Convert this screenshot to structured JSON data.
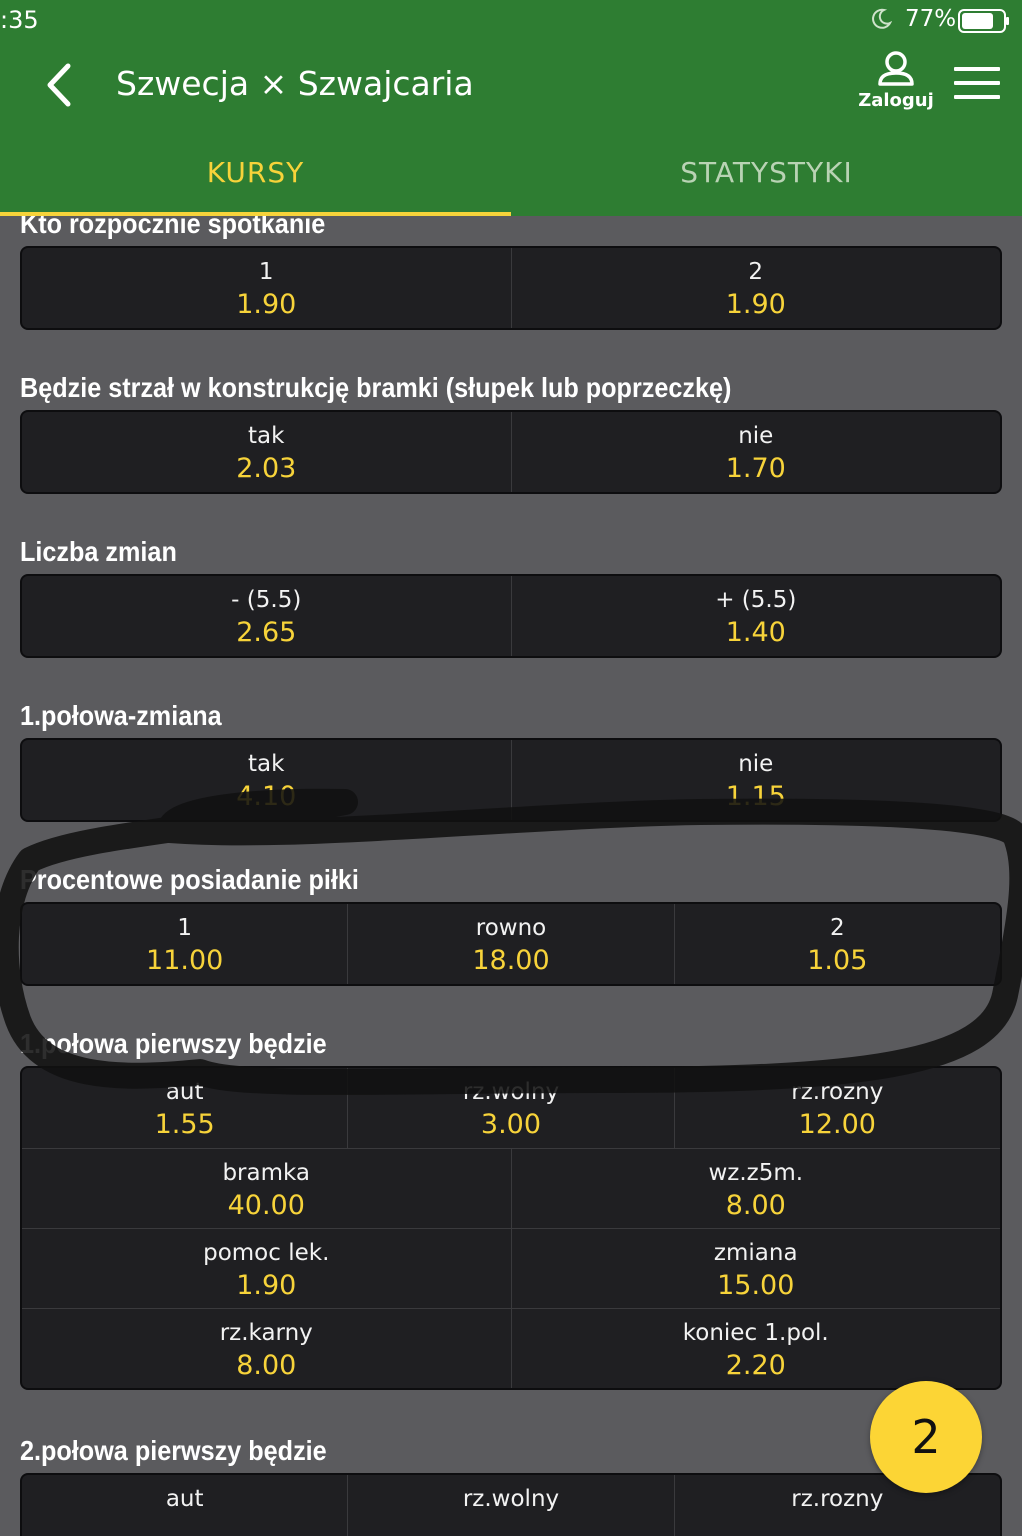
{
  "status_bar": {
    "time": ":35",
    "battery_percent": "77%",
    "battery_level": 0.77
  },
  "header": {
    "back_icon": "chevron-left-icon",
    "title": "Szwecja × Szwajcaria",
    "login_label": "Zaloguj",
    "login_icon": "user-icon",
    "menu_icon": "hamburger-icon"
  },
  "tabs": [
    {
      "label": "KURSY",
      "active": true
    },
    {
      "label": "STATYSTYKI",
      "active": false
    }
  ],
  "colors": {
    "header_bg": "#2e7d32",
    "accent": "#f7d33a",
    "background": "#5b5b5e",
    "odds_box": "#1f1f22"
  },
  "markets": [
    {
      "title": "Kto rozpocznie spotkanie",
      "rows": [
        [
          {
            "name": "1",
            "odd": "1.90"
          },
          {
            "name": "2",
            "odd": "1.90"
          }
        ]
      ]
    },
    {
      "title": "Będzie strzał w konstrukcję bramki (słupek lub poprzeczkę)",
      "rows": [
        [
          {
            "name": "tak",
            "odd": "2.03"
          },
          {
            "name": "nie",
            "odd": "1.70"
          }
        ]
      ]
    },
    {
      "title": "Liczba zmian",
      "rows": [
        [
          {
            "name": "- (5.5)",
            "odd": "2.65"
          },
          {
            "name": "+ (5.5)",
            "odd": "1.40"
          }
        ]
      ]
    },
    {
      "title": "1.połowa-zmiana",
      "rows": [
        [
          {
            "name": "tak",
            "odd": "4.10"
          },
          {
            "name": "nie",
            "odd": "1.15"
          }
        ]
      ]
    },
    {
      "title": "Procentowe posiadanie piłki",
      "rows": [
        [
          {
            "name": "1",
            "odd": "11.00"
          },
          {
            "name": "rowno",
            "odd": "18.00"
          },
          {
            "name": "2",
            "odd": "1.05"
          }
        ]
      ]
    },
    {
      "title": "1.połowa pierwszy będzie",
      "rows": [
        [
          {
            "name": "aut",
            "odd": "1.55"
          },
          {
            "name": "rz.wolny",
            "odd": "3.00"
          },
          {
            "name": "rz.rozny",
            "odd": "12.00"
          }
        ],
        [
          {
            "name": "bramka",
            "odd": "40.00"
          },
          {
            "name": "wz.z5m.",
            "odd": "8.00"
          }
        ],
        [
          {
            "name": "pomoc lek.",
            "odd": "1.90"
          },
          {
            "name": "zmiana",
            "odd": "15.00"
          }
        ],
        [
          {
            "name": "rz.karny",
            "odd": "8.00"
          },
          {
            "name": "koniec 1.pol.",
            "odd": "2.20"
          }
        ]
      ]
    },
    {
      "title": "2.połowa pierwszy będzie",
      "rows": [
        [
          {
            "name": "aut",
            "odd": ""
          },
          {
            "name": "rz.wolny",
            "odd": ""
          },
          {
            "name": "rz.rozny",
            "odd": ""
          }
        ]
      ]
    }
  ],
  "bet_slip": {
    "count": "2"
  }
}
